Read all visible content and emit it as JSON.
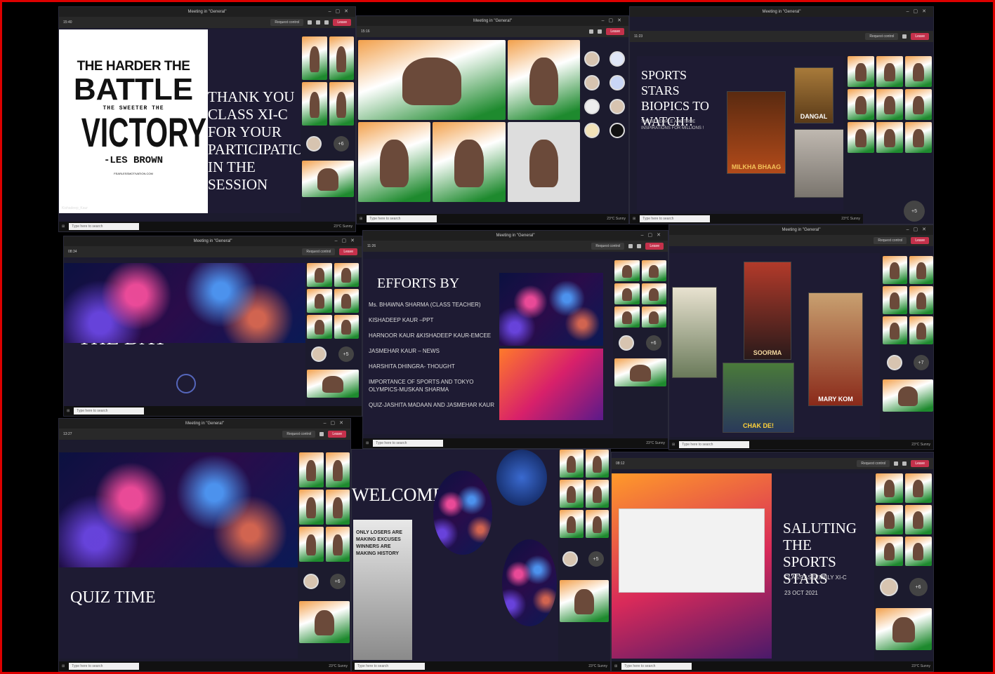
{
  "meeting_title": "Meeting in \"General\"",
  "toolbar": {
    "request_control": "Request control",
    "leave": "Leave"
  },
  "taskbar": {
    "search_placeholder": "Type here to search",
    "weather": "23°C Sunny"
  },
  "windows": {
    "w1": {
      "time": "15:40",
      "quote": {
        "line1": "THE HARDER THE",
        "line2": "BATTLE",
        "line3": "THE SWEETER THE",
        "line4": "VICTORY",
        "author": "-LES BROWN",
        "site": "FEARLESSMOTIVATION.COM"
      },
      "message": "THANK YOU CLASS XI-C FOR YOUR PARTICIPATION IN THE SESSION",
      "presenter": "Kishadeep_Kaur"
    },
    "w2": {
      "time": "15:16"
    },
    "w3": {
      "time": "11:23",
      "title": "SPORTS STARS BIOPICS TO WATCH!!",
      "subtitle": "THESE PEOPLE ARE TRUE INSPIRATIONS FOR MILLIONS !",
      "posters": [
        "MILKHA BHAAG",
        "DANGAL",
        ""
      ],
      "more": "+5"
    },
    "w4": {
      "time": "08:34",
      "slide_text": "THE DAY"
    },
    "w5": {
      "time": "11:26",
      "title": "EFFORTS BY",
      "items": [
        "Ms. BHAWNA SHARMA (CLASS TEACHER)",
        "KISHADEEP KAUR –PPT",
        "HARNOOR KAUR &KISHADEEP KAUR-EMCEE",
        "JASMEHAR KAUR – NEWS",
        "HARSHITA DHINGRA- THOUGHT",
        "IMPORTANCE OF SPORTS AND TOKYO OLYMPICS-MUSKAN SHARMA",
        "QUIZ-JASHITA MADAAN AND JASMEHAR KAUR"
      ]
    },
    "w6": {
      "posters": [
        "",
        "SOORMA",
        "CHAK DE!",
        "MARY KOM"
      ]
    },
    "w7": {
      "time": "13:27",
      "title": "QUIZ TIME"
    },
    "w8": {
      "title": "WELCOME",
      "quote": "ONLY LOSERS ARE MAKING EXCUSES WINNERS ARE MAKING HISTORY"
    },
    "w9": {
      "time": "08:12",
      "title": "SALUTING THE SPORTS STARS",
      "subtitle": "CLASS ASSEMBLY XI-C",
      "date": "23 OCT 2021"
    }
  },
  "colors": {
    "leave": "#c4314b",
    "border": "#dd0000",
    "slide_bg": "#1e1b33"
  }
}
